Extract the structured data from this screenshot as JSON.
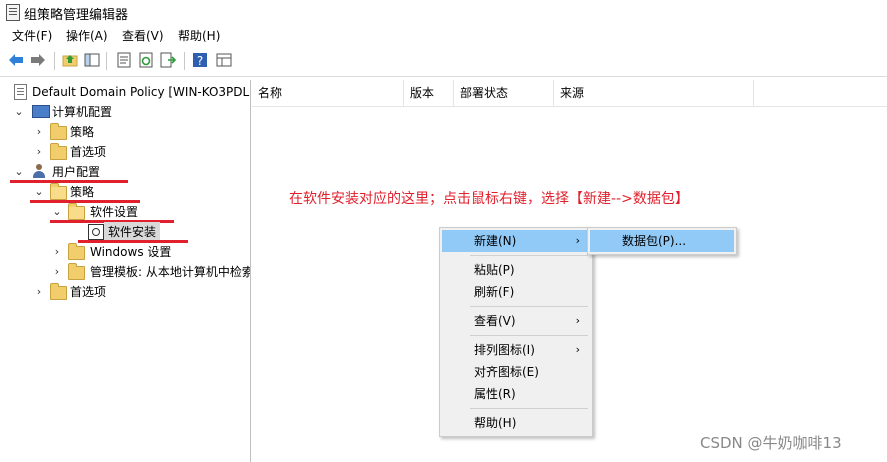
{
  "window": {
    "title": "组策略管理编辑器"
  },
  "menu": [
    "文件(F)",
    "操作(A)",
    "查看(V)",
    "帮助(H)"
  ],
  "toolbar_icons": [
    "back-arrow-icon",
    "forward-arrow-icon",
    "up-folder-icon",
    "show-hide-tree-icon",
    "properties-icon",
    "refresh-icon",
    "export-list-icon",
    "help-icon",
    "view-icon"
  ],
  "tree": {
    "root": "Default Domain Policy [WIN-KO3PDL",
    "computer_config": "计算机配置",
    "policies": "策略",
    "preferences": "首选项",
    "user_config": "用户配置",
    "user_policies": "策略",
    "software_settings": "软件设置",
    "software_install": "软件安装",
    "windows_settings": "Windows 设置",
    "admin_templates": "管理模板: 从本地计算机中检索",
    "user_preferences": "首选项"
  },
  "list": {
    "columns": [
      "名称",
      "版本",
      "部署状态",
      "来源"
    ]
  },
  "annotation": "在软件安装对应的这里；点击鼠标右键，选择【新建-->数据包】",
  "context_menu": {
    "new": "新建(N)",
    "paste": "粘贴(P)",
    "refresh": "刷新(F)",
    "view": "查看(V)",
    "arrange": "排列图标(I)",
    "align": "对齐图标(E)",
    "properties": "属性(R)",
    "help": "帮助(H)"
  },
  "submenu": {
    "package": "数据包(P)..."
  },
  "watermark": "CSDN @牛奶咖啡13",
  "colors": {
    "annotation_red": "#e0202c",
    "menu_highlight": "#91c9f7",
    "menu_bg": "#f0f0f0"
  }
}
